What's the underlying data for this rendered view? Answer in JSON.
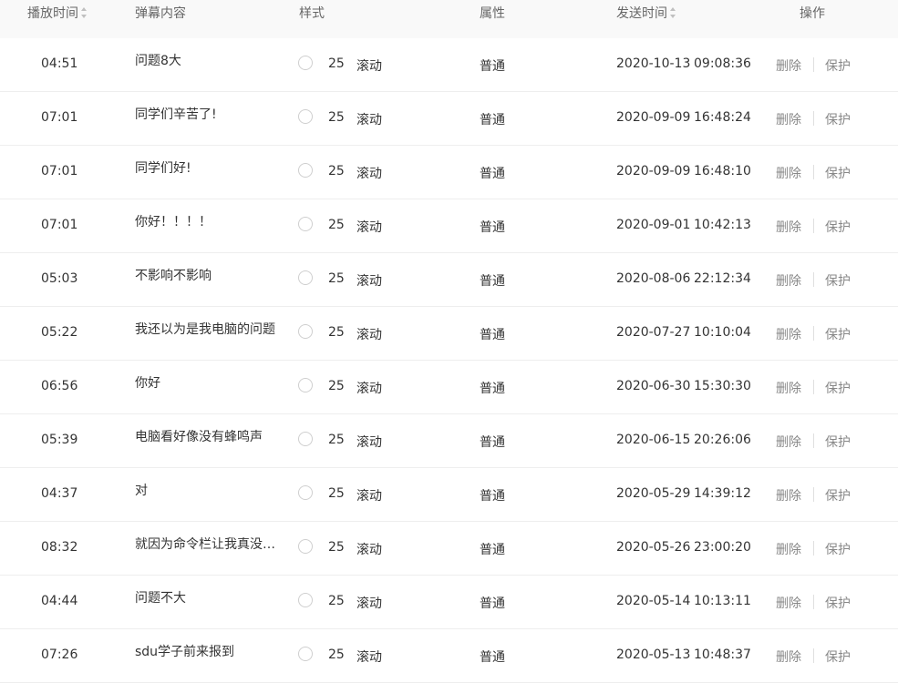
{
  "header": {
    "play_time": "播放时间",
    "content": "弹幕内容",
    "style": "样式",
    "attribute": "属性",
    "send_time": "发送时间",
    "actions": "操作"
  },
  "rows": [
    {
      "play_time": "04:51",
      "content": "问题8大",
      "size": "25",
      "mode": "滚动",
      "attribute": "普通",
      "date": "2020-10-13",
      "time": "09:08:36",
      "delete": "删除",
      "protect": "保护"
    },
    {
      "play_time": "07:01",
      "content": "同学们辛苦了!",
      "size": "25",
      "mode": "滚动",
      "attribute": "普通",
      "date": "2020-09-09",
      "time": "16:48:24",
      "delete": "删除",
      "protect": "保护"
    },
    {
      "play_time": "07:01",
      "content": "同学们好!",
      "size": "25",
      "mode": "滚动",
      "attribute": "普通",
      "date": "2020-09-09",
      "time": "16:48:10",
      "delete": "删除",
      "protect": "保护"
    },
    {
      "play_time": "07:01",
      "content": "你好！！！！",
      "size": "25",
      "mode": "滚动",
      "attribute": "普通",
      "date": "2020-09-01",
      "time": "10:42:13",
      "delete": "删除",
      "protect": "保护"
    },
    {
      "play_time": "05:03",
      "content": "不影响不影响",
      "size": "25",
      "mode": "滚动",
      "attribute": "普通",
      "date": "2020-08-06",
      "time": "22:12:34",
      "delete": "删除",
      "protect": "保护"
    },
    {
      "play_time": "05:22",
      "content": "我还以为是我电脑的问题",
      "size": "25",
      "mode": "滚动",
      "attribute": "普通",
      "date": "2020-07-27",
      "time": "10:10:04",
      "delete": "删除",
      "protect": "保护"
    },
    {
      "play_time": "06:56",
      "content": "你好",
      "size": "25",
      "mode": "滚动",
      "attribute": "普通",
      "date": "2020-06-30",
      "time": "15:30:30",
      "delete": "删除",
      "protect": "保护"
    },
    {
      "play_time": "05:39",
      "content": "电脑看好像没有蜂鸣声",
      "size": "25",
      "mode": "滚动",
      "attribute": "普通",
      "date": "2020-06-15",
      "time": "20:26:06",
      "delete": "删除",
      "protect": "保护"
    },
    {
      "play_time": "04:37",
      "content": "对",
      "size": "25",
      "mode": "滚动",
      "attribute": "普通",
      "date": "2020-05-29",
      "time": "14:39:12",
      "delete": "删除",
      "protect": "保护"
    },
    {
      "play_time": "08:32",
      "content": "就因为命令栏让我真没…",
      "size": "25",
      "mode": "滚动",
      "attribute": "普通",
      "date": "2020-05-26",
      "time": "23:00:20",
      "delete": "删除",
      "protect": "保护"
    },
    {
      "play_time": "04:44",
      "content": "问题不大",
      "size": "25",
      "mode": "滚动",
      "attribute": "普通",
      "date": "2020-05-14",
      "time": "10:13:11",
      "delete": "删除",
      "protect": "保护"
    },
    {
      "play_time": "07:26",
      "content": "sdu学子前来报到",
      "size": "25",
      "mode": "滚动",
      "attribute": "普通",
      "date": "2020-05-13",
      "time": "10:48:37",
      "delete": "删除",
      "protect": "保护"
    }
  ]
}
